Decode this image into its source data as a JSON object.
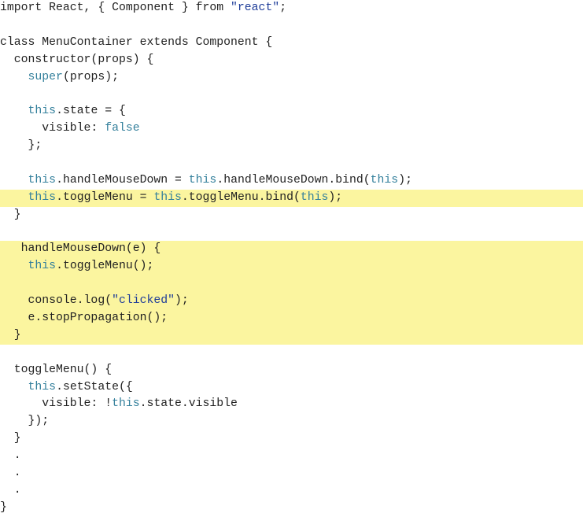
{
  "highlight_color": "#fbf59f",
  "keyword_color": "#34809c",
  "string_color": "#1f3d99",
  "lines": [
    {
      "hl": false,
      "tokens": [
        {
          "t": "import React, { Component } from ",
          "c": "plain"
        },
        {
          "t": "\"react\"",
          "c": "str"
        },
        {
          "t": ";",
          "c": "plain"
        }
      ]
    },
    {
      "hl": false,
      "tokens": []
    },
    {
      "hl": false,
      "tokens": [
        {
          "t": "class MenuContainer extends Component {",
          "c": "plain"
        }
      ]
    },
    {
      "hl": false,
      "tokens": [
        {
          "t": "  constructor(props) {",
          "c": "plain"
        }
      ]
    },
    {
      "hl": false,
      "tokens": [
        {
          "t": "    ",
          "c": "plain"
        },
        {
          "t": "super",
          "c": "kw"
        },
        {
          "t": "(props);",
          "c": "plain"
        }
      ]
    },
    {
      "hl": false,
      "tokens": []
    },
    {
      "hl": false,
      "tokens": [
        {
          "t": "    ",
          "c": "plain"
        },
        {
          "t": "this",
          "c": "kw"
        },
        {
          "t": ".state = {",
          "c": "plain"
        }
      ]
    },
    {
      "hl": false,
      "tokens": [
        {
          "t": "      visible: ",
          "c": "plain"
        },
        {
          "t": "false",
          "c": "lit"
        }
      ]
    },
    {
      "hl": false,
      "tokens": [
        {
          "t": "    };",
          "c": "plain"
        }
      ]
    },
    {
      "hl": false,
      "tokens": []
    },
    {
      "hl": false,
      "tokens": [
        {
          "t": "    ",
          "c": "plain"
        },
        {
          "t": "this",
          "c": "kw"
        },
        {
          "t": ".handleMouseDown = ",
          "c": "plain"
        },
        {
          "t": "this",
          "c": "kw"
        },
        {
          "t": ".handleMouseDown.bind(",
          "c": "plain"
        },
        {
          "t": "this",
          "c": "kw"
        },
        {
          "t": ");",
          "c": "plain"
        }
      ]
    },
    {
      "hl": true,
      "tokens": [
        {
          "t": "    ",
          "c": "plain"
        },
        {
          "t": "this",
          "c": "kw"
        },
        {
          "t": ".toggleMenu = ",
          "c": "plain"
        },
        {
          "t": "this",
          "c": "kw"
        },
        {
          "t": ".toggleMenu.bind(",
          "c": "plain"
        },
        {
          "t": "this",
          "c": "kw"
        },
        {
          "t": ");",
          "c": "plain"
        }
      ]
    },
    {
      "hl": false,
      "tokens": [
        {
          "t": "  }",
          "c": "plain"
        }
      ]
    },
    {
      "hl": false,
      "tokens": []
    },
    {
      "hl": true,
      "tokens": [
        {
          "t": "   handleMouseDown(e) {",
          "c": "plain"
        }
      ]
    },
    {
      "hl": true,
      "tokens": [
        {
          "t": "    ",
          "c": "plain"
        },
        {
          "t": "this",
          "c": "kw"
        },
        {
          "t": ".toggleMenu();",
          "c": "plain"
        }
      ]
    },
    {
      "hl": true,
      "tokens": []
    },
    {
      "hl": true,
      "tokens": [
        {
          "t": "    console.log(",
          "c": "plain"
        },
        {
          "t": "\"clicked\"",
          "c": "str"
        },
        {
          "t": ");",
          "c": "plain"
        }
      ]
    },
    {
      "hl": true,
      "tokens": [
        {
          "t": "    e.stopPropagation();",
          "c": "plain"
        }
      ]
    },
    {
      "hl": true,
      "tokens": [
        {
          "t": "  }",
          "c": "plain"
        }
      ]
    },
    {
      "hl": false,
      "tokens": []
    },
    {
      "hl": false,
      "tokens": [
        {
          "t": "  toggleMenu() {",
          "c": "plain"
        }
      ]
    },
    {
      "hl": false,
      "tokens": [
        {
          "t": "    ",
          "c": "plain"
        },
        {
          "t": "this",
          "c": "kw"
        },
        {
          "t": ".setState({",
          "c": "plain"
        }
      ]
    },
    {
      "hl": false,
      "tokens": [
        {
          "t": "      visible: !",
          "c": "plain"
        },
        {
          "t": "this",
          "c": "kw"
        },
        {
          "t": ".state.visible",
          "c": "plain"
        }
      ]
    },
    {
      "hl": false,
      "tokens": [
        {
          "t": "    });",
          "c": "plain"
        }
      ]
    },
    {
      "hl": false,
      "tokens": [
        {
          "t": "  }",
          "c": "plain"
        }
      ]
    },
    {
      "hl": false,
      "tokens": [
        {
          "t": "  .",
          "c": "plain"
        }
      ]
    },
    {
      "hl": false,
      "tokens": [
        {
          "t": "  .",
          "c": "plain"
        }
      ]
    },
    {
      "hl": false,
      "tokens": [
        {
          "t": "  .",
          "c": "plain"
        }
      ]
    },
    {
      "hl": false,
      "tokens": [
        {
          "t": "}",
          "c": "plain"
        }
      ]
    }
  ]
}
